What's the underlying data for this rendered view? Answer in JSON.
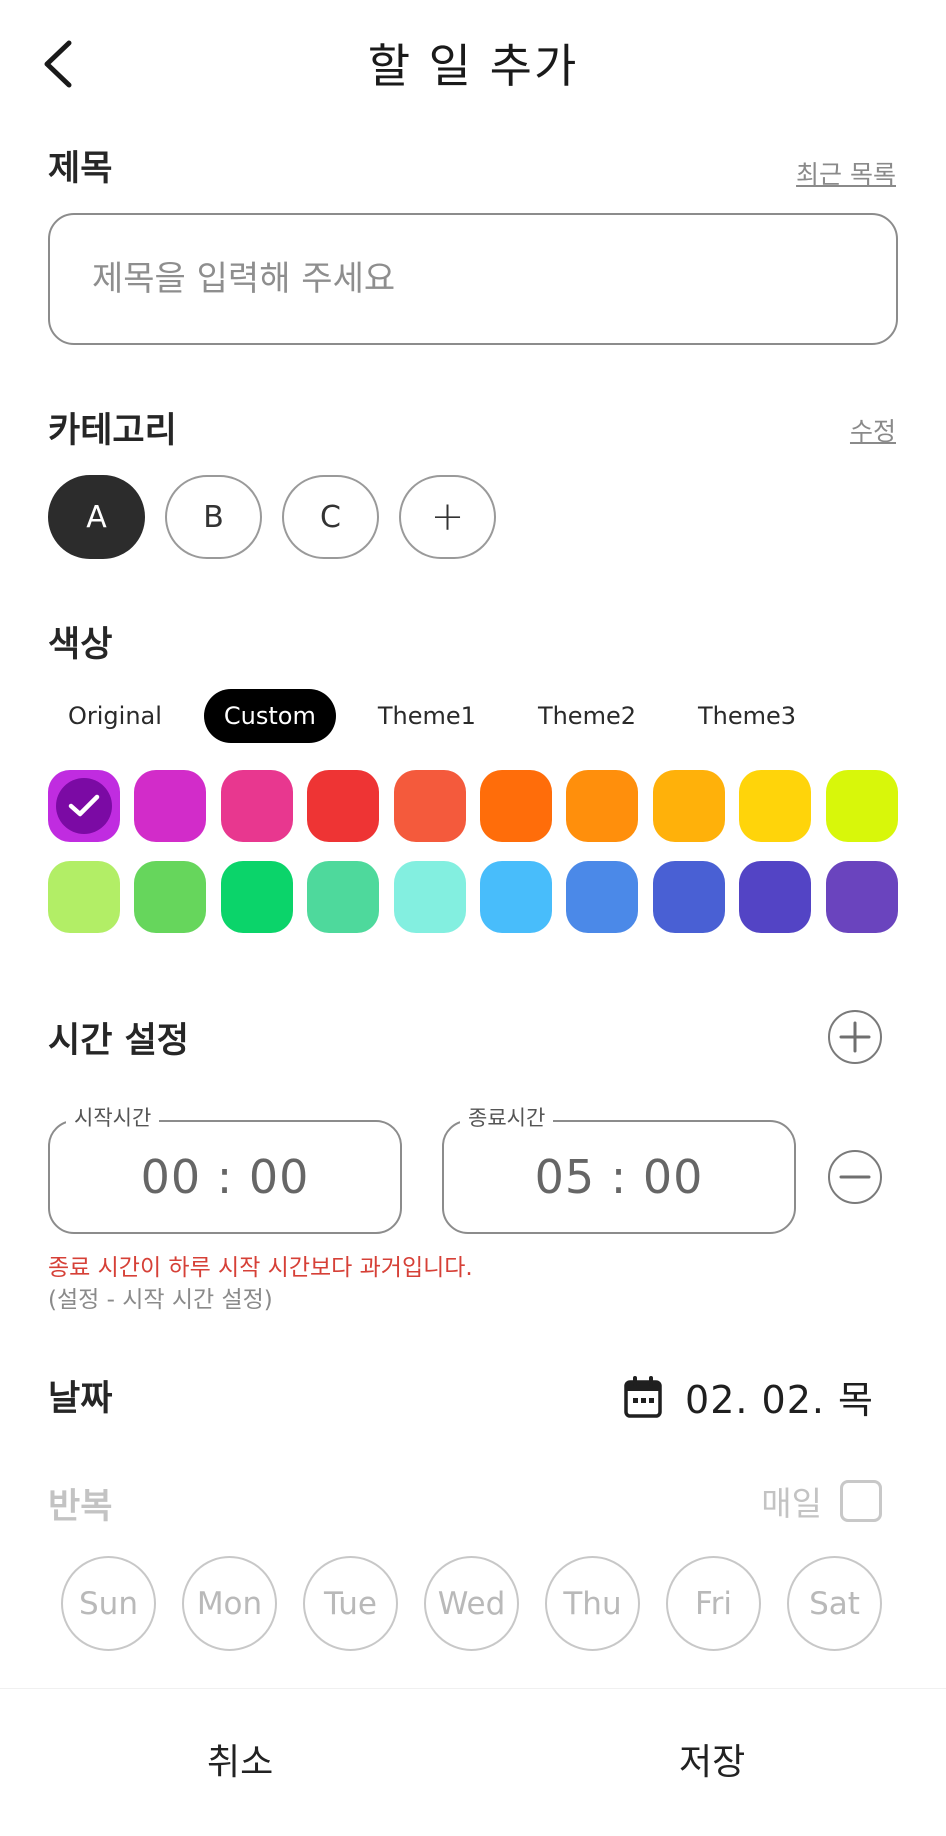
{
  "header": {
    "title": "할 일 추가"
  },
  "title_section": {
    "label": "제목",
    "recent_link": "최근 목록",
    "placeholder": "제목을 입력해 주세요"
  },
  "category_section": {
    "label": "카테고리",
    "edit_link": "수정",
    "chips": [
      {
        "label": "A",
        "selected": true
      },
      {
        "label": "B",
        "selected": false
      },
      {
        "label": "C",
        "selected": false
      }
    ],
    "add_label": "+"
  },
  "color_section": {
    "label": "색상",
    "themes": [
      {
        "label": "Original",
        "selected": false
      },
      {
        "label": "Custom",
        "selected": true
      },
      {
        "label": "Theme1",
        "selected": false
      },
      {
        "label": "Theme2",
        "selected": false
      },
      {
        "label": "Theme3",
        "selected": false
      }
    ],
    "selected_index": 0,
    "swatches": [
      "#c02ce0",
      "#d22cc9",
      "#e8378f",
      "#ee3434",
      "#f45a3c",
      "#ff6d0a",
      "#ff8f0c",
      "#ffb10a",
      "#ffd40a",
      "#d8f70a",
      "#b2ee66",
      "#66d65c",
      "#0bd46a",
      "#4ed99c",
      "#83efe0",
      "#48bdfb",
      "#4b89e8",
      "#4960d4",
      "#5344c5",
      "#6a44be"
    ]
  },
  "time_section": {
    "label": "시간 설정",
    "start_label": "시작시간",
    "start_value": "00 : 00",
    "end_label": "종료시간",
    "end_value": "05 : 00",
    "error": "종료 시간이 하루 시작 시간보다 과거입니다.",
    "hint": "(설정 - 시작 시간 설정)"
  },
  "date_section": {
    "label": "날짜",
    "value": "02. 02. 목"
  },
  "repeat_section": {
    "label": "반복",
    "everyday_label": "매일",
    "everyday_checked": false,
    "days": [
      "Sun",
      "Mon",
      "Tue",
      "Wed",
      "Thu",
      "Fri",
      "Sat"
    ]
  },
  "footer": {
    "cancel": "취소",
    "save": "저장"
  }
}
